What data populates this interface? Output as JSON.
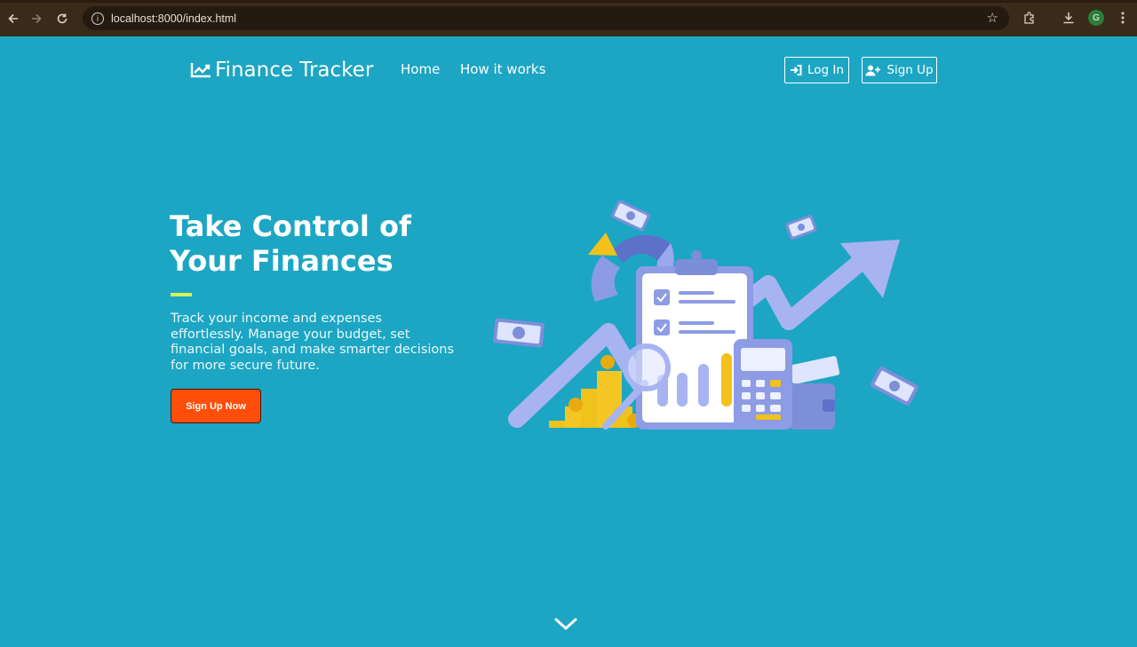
{
  "browser": {
    "url": "localhost:8000/index.html",
    "profile_initial": "G",
    "icons": [
      "back-icon",
      "forward-icon",
      "reload-icon",
      "info-icon",
      "star-icon",
      "extensions-icon",
      "download-icon",
      "menu-icon"
    ]
  },
  "header": {
    "brand": "Finance Tracker",
    "brand_icon": "chart-line-icon",
    "nav": [
      "Home",
      "How it works"
    ],
    "login_label": "Log In",
    "signup_label": "Sign Up"
  },
  "hero": {
    "title_line1": "Take Control of",
    "title_line2": "Your Finances",
    "description": "Track your income and expenses effortlessly. Manage your budget, set financial goals, and make smarter decisions for more secure future.",
    "cta_label": "Sign Up Now",
    "illustration": "finance-illustration"
  },
  "colors": {
    "background": "#1ca6c3",
    "accent": "#d8f25a",
    "cta": "#ff4d0a",
    "chrome": "#3a2a1a"
  }
}
